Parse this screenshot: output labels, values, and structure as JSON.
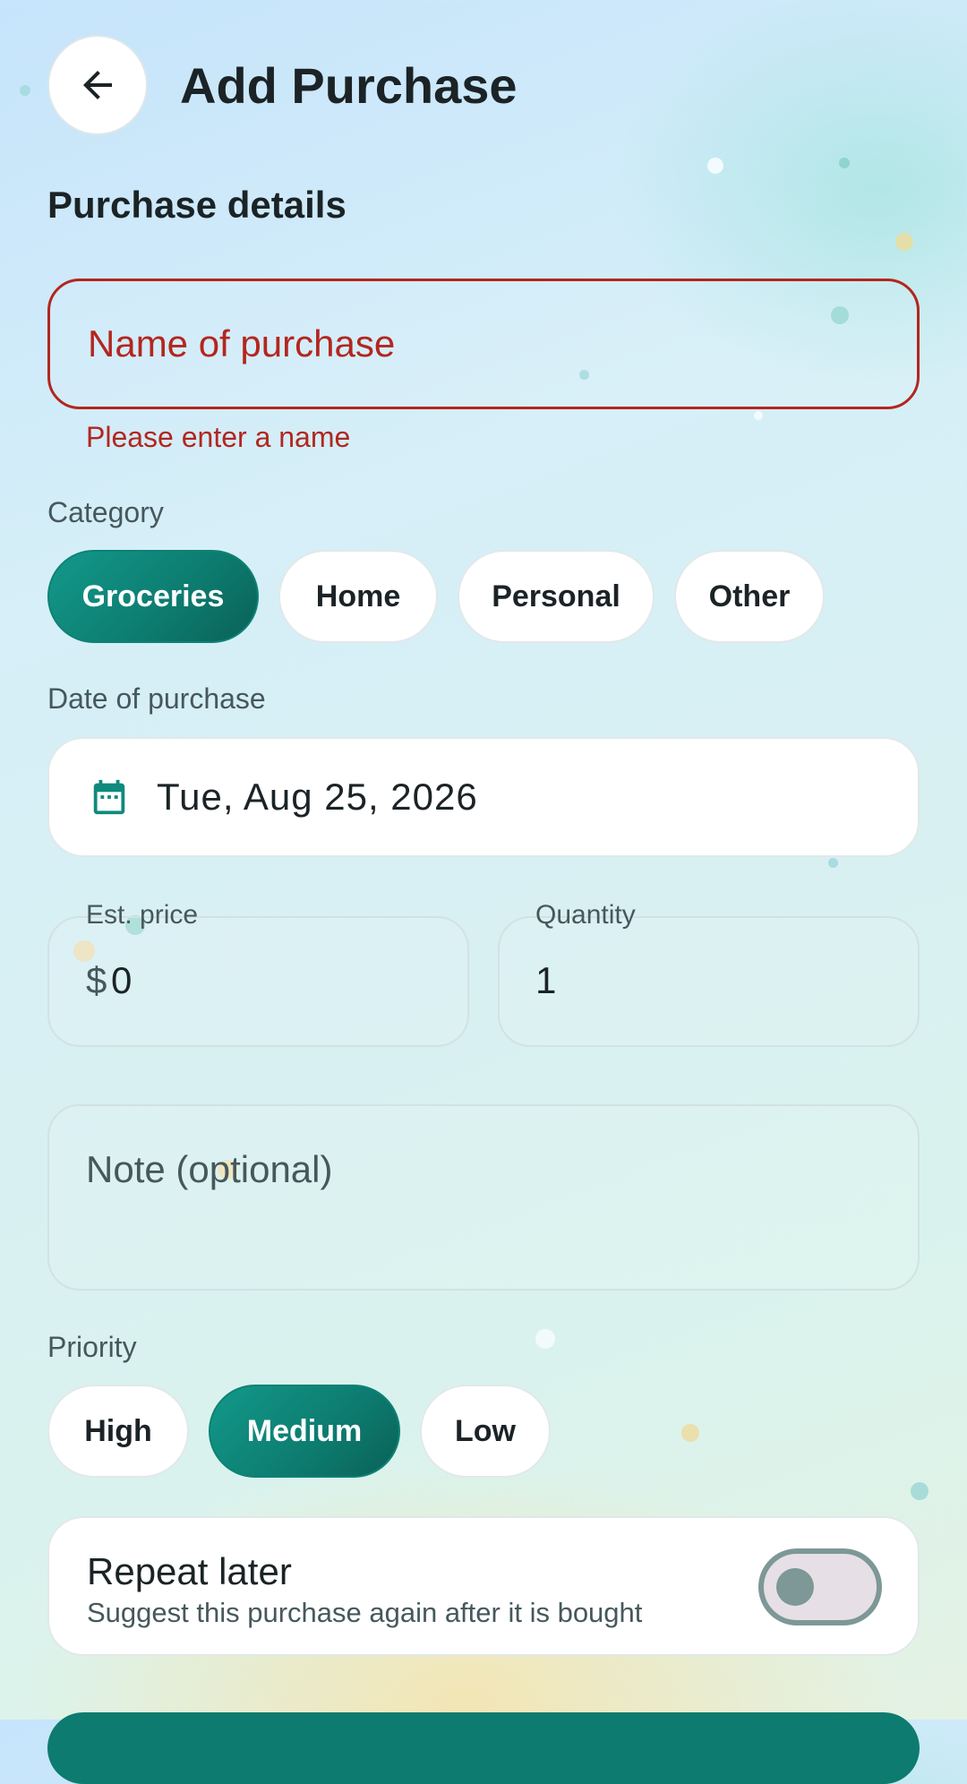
{
  "header": {
    "title": "Add Purchase",
    "back_icon": "arrow-left-icon"
  },
  "section_title": "Purchase details",
  "name_field": {
    "placeholder": "Name of purchase",
    "value": "",
    "error": "Please enter a name"
  },
  "category": {
    "label": "Category",
    "options": [
      "Groceries",
      "Home",
      "Personal",
      "Other"
    ],
    "selected": "Groceries"
  },
  "date": {
    "label": "Date of purchase",
    "value": "Tue, Aug 25, 2026",
    "icon": "calendar-icon"
  },
  "price": {
    "label": "Est. price",
    "currency": "$",
    "value": "0"
  },
  "quantity": {
    "label": "Quantity",
    "value": "1"
  },
  "note": {
    "placeholder": "Note (optional)",
    "value": ""
  },
  "priority": {
    "label": "Priority",
    "options": [
      "High",
      "Medium",
      "Low"
    ],
    "selected": "Medium"
  },
  "repeat": {
    "title": "Repeat later",
    "subtitle": "Suggest this purchase again after it is bought",
    "enabled": false
  },
  "colors": {
    "accent": "#0d7b6f",
    "error": "#b3261e"
  }
}
